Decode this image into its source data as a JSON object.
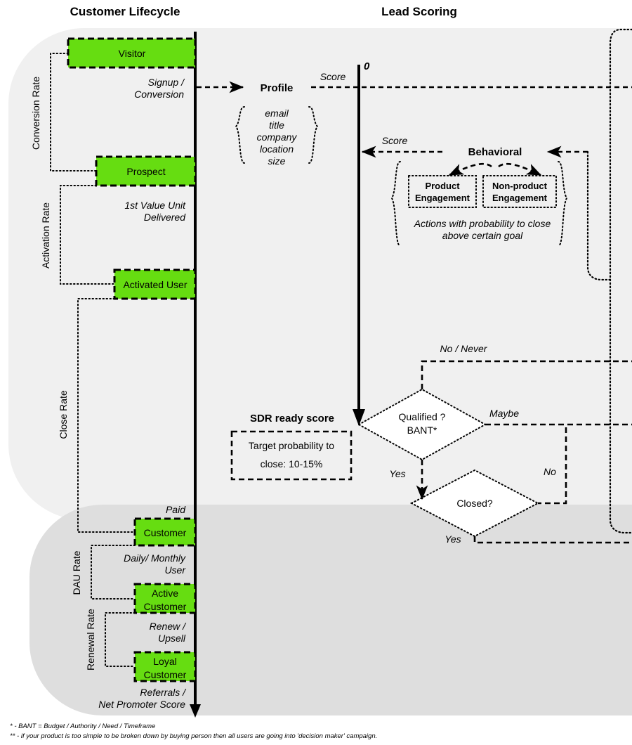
{
  "titles": {
    "left": "Customer Lifecycle",
    "right": "Lead Scoring"
  },
  "colors": {
    "stage_green": "#66dd11",
    "band_light": "#f0f0f0",
    "band_dark": "#dedede",
    "stroke": "#000000"
  },
  "lifecycle": {
    "stages": [
      {
        "label": "Visitor"
      },
      {
        "label": "Prospect"
      },
      {
        "label": "Activated User"
      },
      {
        "label": "Customer"
      },
      {
        "label": "Active Customer"
      },
      {
        "label": "Loyal Customer"
      }
    ],
    "transitions": [
      {
        "label_line1": "Signup /",
        "label_line2": "Conversion"
      },
      {
        "label_line1": "1st Value Unit",
        "label_line2": "Delivered"
      },
      {
        "label_line1": "Paid",
        "label_line2": ""
      },
      {
        "label_line1": "Daily/ Monthly",
        "label_line2": "User"
      },
      {
        "label_line1": "Renew /",
        "label_line2": "Upsell"
      },
      {
        "label_line1": "Referrals /",
        "label_line2": "Net Promoter Score"
      }
    ],
    "rates": [
      {
        "label": "Conversion Rate"
      },
      {
        "label": "Activation Rate"
      },
      {
        "label": "Close Rate"
      },
      {
        "label": "DAU Rate"
      },
      {
        "label": "Renewal Rate"
      }
    ]
  },
  "scoring": {
    "axis_zero": "0",
    "profile": {
      "title": "Profile",
      "score_label": "Score",
      "attributes": [
        "email",
        "title",
        "company",
        "location",
        "size"
      ]
    },
    "behavioral": {
      "title": "Behavioral",
      "score_label": "Score",
      "boxes": [
        {
          "line1": "Product",
          "line2": "Engagement"
        },
        {
          "line1": "Non-product",
          "line2": "Engagement"
        }
      ],
      "note_line1": "Actions with probability to close",
      "note_line2": "above certain goal"
    },
    "sdr": {
      "title": "SDR ready score",
      "body_line1": "Target probability to",
      "body_line2": "close: 10-15%"
    },
    "decisions": [
      {
        "line1": "Qualified ?",
        "line2": "BANT*"
      },
      {
        "line1": "Closed?",
        "line2": ""
      }
    ],
    "edges": {
      "no_never": "No / Never",
      "maybe": "Maybe",
      "yes_qualified": "Yes",
      "no_closed": "No",
      "yes_closed": "Yes"
    }
  },
  "footnotes": [
    "* - BANT = Budget / Authority / Need / Timeframe",
    "** - if your product is too simple to be broken down by buying person then all users are going into 'decision maker' campaign."
  ]
}
